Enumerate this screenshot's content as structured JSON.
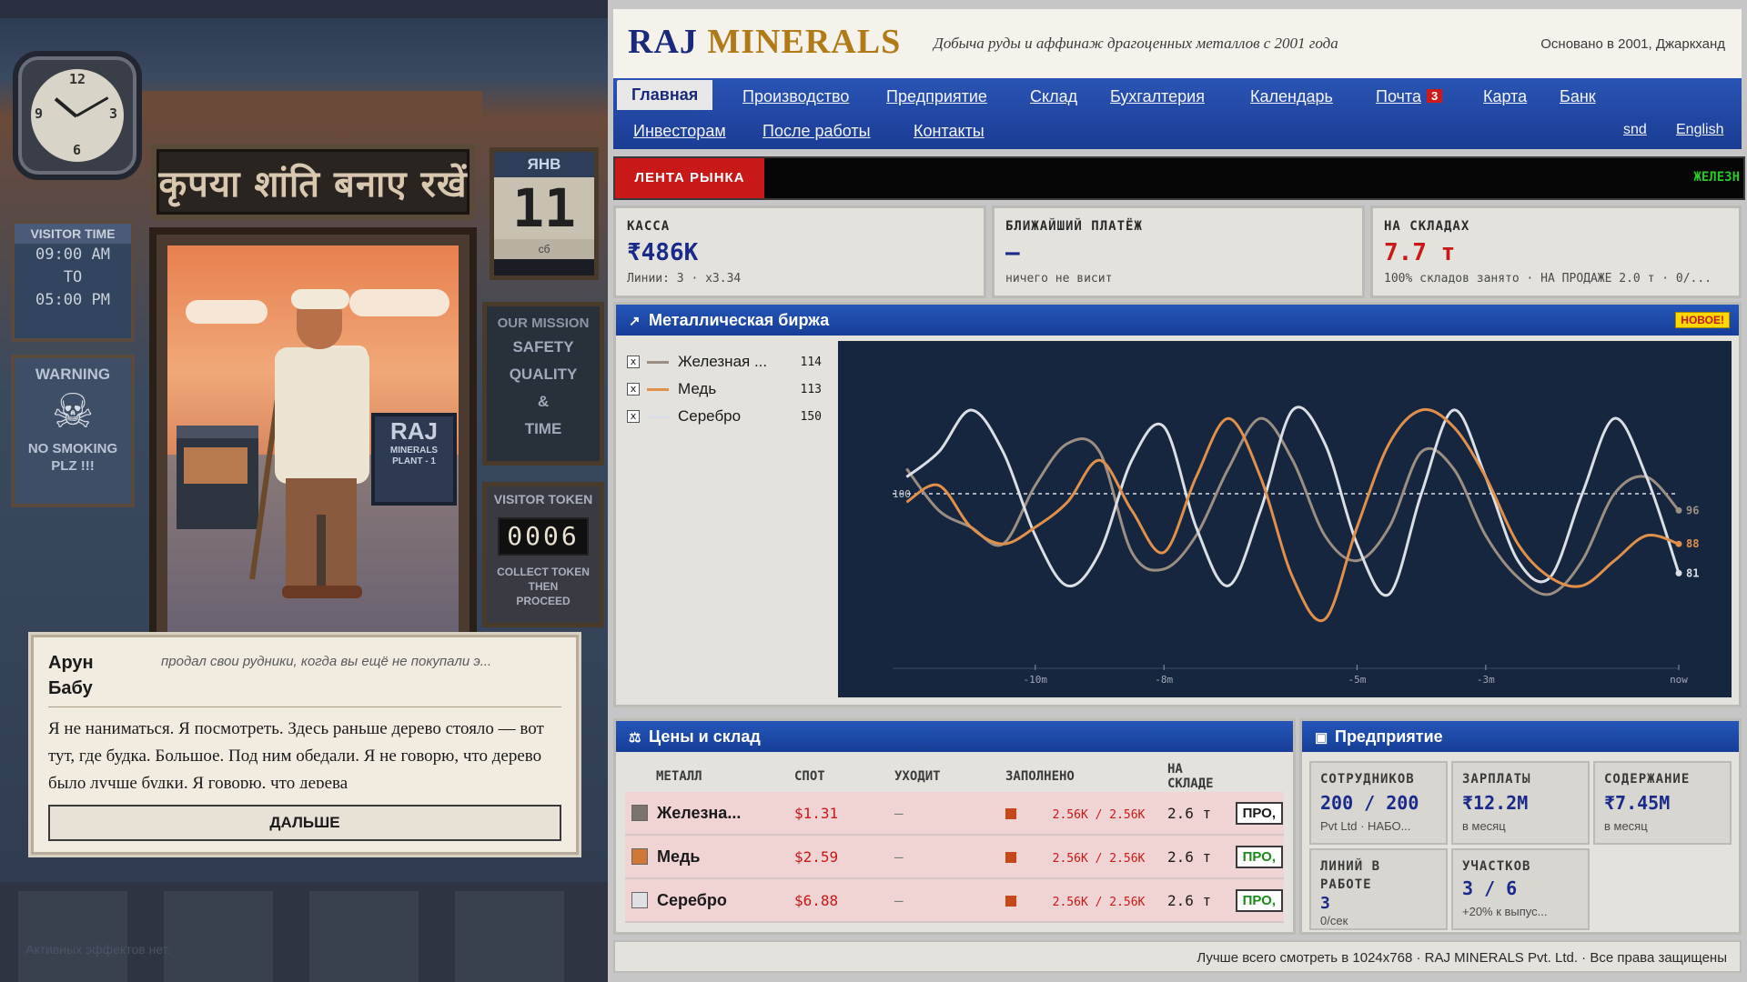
{
  "scene": {
    "clock_numbers": [
      "12",
      "9",
      "3",
      "6"
    ],
    "sign_hindi": "कृपया शांति बनाए रखें",
    "calendar": {
      "month": "ЯНВ",
      "day": "11",
      "weekday": "сб"
    },
    "visitor_time": {
      "title": "VISITOR TIME",
      "lines": [
        "09:00 AM",
        "TO",
        "05:00 PM"
      ]
    },
    "warning": {
      "title": "WARNING",
      "text": [
        "NO SMOKING",
        "PLZ !!!"
      ]
    },
    "plant_sign": {
      "big": "RAJ",
      "small": "MINERALS PLANT - 1"
    },
    "mission": {
      "title": "OUR MISSION",
      "lines": [
        "SAFETY",
        "QUALITY",
        "&",
        "TIME"
      ]
    },
    "token": {
      "title": "VISITOR TOKEN",
      "number": "0006",
      "note": [
        "COLLECT TOKEN",
        "THEN",
        "PROCEED"
      ]
    },
    "effects": "Активных эффектов нет."
  },
  "dialogue": {
    "name": "Арун Бабу",
    "tagline": "продал свои рудники, когда вы ещё не покупали э...",
    "text": "Я не наниматься. Я посмотреть. Здесь раньше дерево стояло — вот тут, где будка. Большое. Под ним обедали. Я не говорю, что дерево было лучше будки. Я говорю, что дерева",
    "next": "ДАЛЬШЕ"
  },
  "header": {
    "logo_a": "RAJ",
    "logo_b": "MINERALS",
    "slogan": "Добыча руды и аффинаж драгоценных металлов с 2001 года",
    "founded": "Основано в 2001, Джаркханд"
  },
  "nav": {
    "row1": [
      "Главная",
      "Производство",
      "Предприятие",
      "Склад",
      "Бухгалтерия",
      "Календарь",
      "Почта",
      "Карта",
      "Банк"
    ],
    "mail_badge": "3",
    "row2": [
      "Инвесторам",
      "После работы",
      "Контакты"
    ],
    "lang": [
      "snd",
      "English"
    ]
  },
  "ticker": {
    "label": "ЛЕНТА РЫНКА",
    "text": "ЖЕЛЕЗН"
  },
  "cards": [
    {
      "title": "КАССА",
      "value": "₹486K",
      "sub": "Линии: 3 · x3.34"
    },
    {
      "title": "БЛИЖАЙШИЙ ПЛАТЁЖ",
      "value": "—",
      "sub": "ничего не висит"
    },
    {
      "title": "НА СКЛАДАХ",
      "value": "7.7 т",
      "sub": "100% складов занято · НА ПРОДАЖЕ 2.0 т · 0/..."
    }
  ],
  "exchange": {
    "title": "Металлическая биржа",
    "badge": "НОВОЕ!",
    "legend": [
      {
        "name": "Железная ...",
        "value": "114",
        "color": "#9a8f82"
      },
      {
        "name": "Медь",
        "value": "113",
        "color": "#e0904a"
      },
      {
        "name": "Серебро",
        "value": "150",
        "color": "#dadfe6"
      }
    ],
    "check": "x"
  },
  "chart_data": {
    "type": "line",
    "x": [
      -12,
      -11.5,
      -11,
      -10.5,
      -10,
      -9.5,
      -9,
      -8.5,
      -8,
      -7.5,
      -7,
      -6.5,
      -6,
      -5.5,
      -5,
      -4.5,
      -4,
      -3.5,
      -3,
      -2.5,
      -2,
      -1.5,
      -1,
      -0.5,
      0
    ],
    "x_ticks": [
      -10,
      -8,
      -5,
      -3,
      0
    ],
    "x_tick_labels": [
      "-10m",
      "-8m",
      "-5m",
      "-3m",
      "now"
    ],
    "reference_line": 100,
    "reference_label": "100",
    "series": [
      {
        "name": "Железная ...",
        "color": "#9a8f82",
        "values": [
          106,
          96,
          92,
          88,
          102,
          112,
          110,
          86,
          82,
          90,
          106,
          118,
          108,
          90,
          84,
          92,
          110,
          106,
          90,
          80,
          76,
          84,
          100,
          104,
          96
        ],
        "end_label": "96"
      },
      {
        "name": "Медь",
        "color": "#e0904a",
        "values": [
          98,
          102,
          92,
          88,
          92,
          98,
          108,
          96,
          86,
          104,
          118,
          104,
          80,
          70,
          92,
          112,
          120,
          116,
          104,
          88,
          80,
          78,
          84,
          90,
          88
        ],
        "end_label": "88"
      },
      {
        "name": "Серебро",
        "color": "#dadfe6",
        "values": [
          104,
          110,
          120,
          110,
          90,
          78,
          86,
          108,
          116,
          92,
          78,
          96,
          120,
          112,
          88,
          76,
          100,
          120,
          104,
          84,
          80,
          100,
          118,
          104,
          81
        ],
        "end_label": "81"
      }
    ]
  },
  "inventory": {
    "title": "Цены и склад",
    "headers": [
      "МЕТАЛЛ",
      "СПОТ",
      "УХОДИТ",
      "ЗАПОЛНЕНО",
      "НА СКЛАДЕ"
    ],
    "rows": [
      {
        "name": "Железна...",
        "swatch": "#7a746c",
        "spot": "$1.31",
        "out": "—",
        "filled": "2.56K / 2.56K",
        "stock": "2.6 т",
        "sell": "ПРО,",
        "sell_green": false
      },
      {
        "name": "Медь",
        "swatch": "#d07838",
        "spot": "$2.59",
        "out": "—",
        "filled": "2.56K / 2.56K",
        "stock": "2.6 т",
        "sell": "ПРО,",
        "sell_green": true
      },
      {
        "name": "Серебро",
        "swatch": "#e0e0e4",
        "spot": "$6.88",
        "out": "—",
        "filled": "2.56K / 2.56K",
        "stock": "2.6 т",
        "sell": "ПРО,",
        "sell_green": true
      }
    ]
  },
  "enterprise": {
    "title": "Предприятие",
    "cells": [
      {
        "title": "СОТРУДНИКОВ",
        "value": "200 / 200",
        "sub": "Pvt Ltd · НАБО..."
      },
      {
        "title": "ЗАРПЛАТЫ",
        "value": "₹12.2M",
        "sub": "в месяц"
      },
      {
        "title": "СОДЕРЖАНИЕ",
        "value": "₹7.45M",
        "sub": "в месяц"
      },
      {
        "title": "ЛИНИЙ В РАБОТЕ",
        "value": "3",
        "sub": "0/сек"
      },
      {
        "title": "УЧАСТКОВ",
        "value": "3 / 6",
        "sub": "+20% к выпус..."
      }
    ]
  },
  "footer": "Лучше всего смотреть в 1024x768 · RAJ MINERALS Pvt. Ltd. · Все права защищены"
}
